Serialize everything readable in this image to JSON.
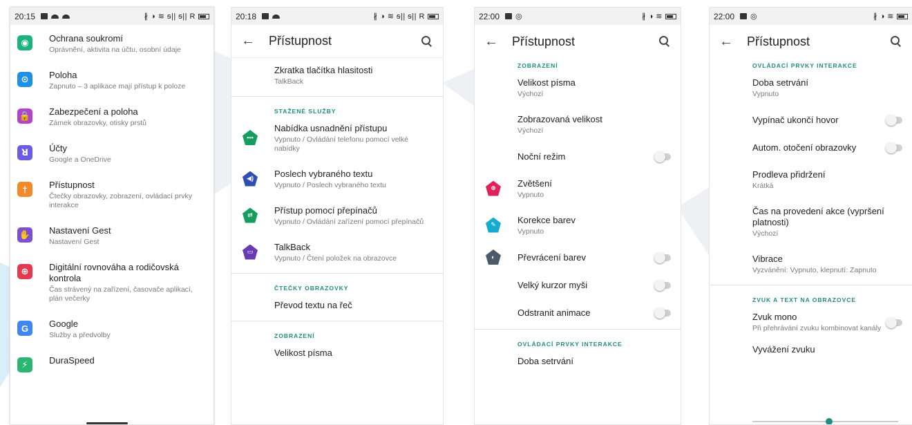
{
  "colors": {
    "accent": "#1e8e7e"
  },
  "phone1": {
    "status": {
      "time": "20:15",
      "right": "∦ ◑ ≋ ᵴ|| ᵴ|| R"
    },
    "items": [
      {
        "icon": "eye-lock-icon",
        "color": "#1bb37e",
        "title": "Ochrana soukromí",
        "subtitle": "Oprávnění, aktivita na účtu, osobní údaje"
      },
      {
        "icon": "location-pin-icon",
        "color": "#1e90e5",
        "title": "Poloha",
        "subtitle": "Zapnuto – 3 aplikace mají přístup k poloze"
      },
      {
        "icon": "padlock-icon",
        "color": "#b344c9",
        "title": "Zabezpečení a poloha",
        "subtitle": "Zámek obrazovky, otisky prstů"
      },
      {
        "icon": "person-icon",
        "color": "#6b5ce6",
        "title": "Účty",
        "subtitle": "Google a OneDrive"
      },
      {
        "icon": "accessibility-icon",
        "color": "#f28a2a",
        "title": "Přístupnost",
        "subtitle": "Čtečky obrazovky, zobrazení, ovládací prvky interakce"
      },
      {
        "icon": "hand-gesture-icon",
        "color": "#7b4fd6",
        "title": "Nastavení Gest",
        "subtitle": "Nastavení Gest"
      },
      {
        "icon": "heart-plus-icon",
        "color": "#e23b4f",
        "title": "Digitální rovnováha a rodičovská kontrola",
        "subtitle": "Čas strávený na zařízení, časovače aplikací, plán večerky"
      },
      {
        "icon": "google-g-icon",
        "color": "#3f86f0",
        "title": "Google",
        "subtitle": "Služby a předvolby"
      },
      {
        "icon": "rocket-icon",
        "color": "#2bb673",
        "title": "DuraSpeed",
        "subtitle": ""
      }
    ]
  },
  "phone2": {
    "status": {
      "time": "20:18",
      "right": "∦ ◑ ≋ ᵴ|| ᵴ|| R"
    },
    "title": "Přístupnost",
    "top_item": {
      "title": "Zkratka tlačítka hlasitosti",
      "subtitle": "TalkBack"
    },
    "section1": "STAŽENÉ SLUŽBY",
    "services": [
      {
        "icon": "menu-dots-icon",
        "color": "#159d5f",
        "glyph": "•••",
        "title": "Nabídka usnadnění přístupu",
        "subtitle": "Vypnuto / Ovládání telefonu pomocí velké nabídky"
      },
      {
        "icon": "speaker-icon",
        "color": "#2f4fb5",
        "glyph": "◀)",
        "title": "Poslech vybraného textu",
        "subtitle": "Vypnuto / Poslech vybraného textu"
      },
      {
        "icon": "switch-access-icon",
        "color": "#159d5f",
        "glyph": "⇄",
        "title": "Přístup pomocí přepínačů",
        "subtitle": "Vypnuto / Ovládání zařízení pomocí přepínačů"
      },
      {
        "icon": "talkback-icon",
        "color": "#6a3ab5",
        "glyph": "▭",
        "title": "TalkBack",
        "subtitle": "Vypnuto / Čtení položek na obrazovce"
      }
    ],
    "section2": "ČTEČKY OBRAZOVKY",
    "tts": "Převod textu na řeč",
    "section3": "ZOBRAZENÍ",
    "font_size": "Velikost písma"
  },
  "phone3": {
    "status": {
      "time": "22:00",
      "right": "∦ ◑ ≋"
    },
    "title": "Přístupnost",
    "section1": "ZOBRAZENÍ",
    "font_size": {
      "title": "Velikost písma",
      "subtitle": "Výchozí"
    },
    "display_size": {
      "title": "Zobrazovaná velikost",
      "subtitle": "Výchozí"
    },
    "night_mode": "Noční režim",
    "magnification": {
      "icon": "magnifier-icon",
      "color": "#e0215a",
      "title": "Zvětšení",
      "subtitle": "Vypnuto"
    },
    "color_correction": {
      "icon": "pen-icon",
      "color": "#17aacf",
      "title": "Korekce barev",
      "subtitle": "Vypnuto"
    },
    "color_inversion": {
      "icon": "contrast-icon",
      "color": "#4a5a6a",
      "title": "Převrácení barev"
    },
    "large_cursor": "Velký kurzor myši",
    "remove_animations": "Odstranit animace",
    "section2": "OVLÁDACÍ PRVKY INTERAKCE",
    "dwell": "Doba setrvání"
  },
  "phone4": {
    "status": {
      "time": "22:00",
      "right": "∦ ◑ ≋"
    },
    "title": "Přístupnost",
    "section1": "OVLÁDACÍ PRVKY INTERAKCE",
    "dwell": {
      "title": "Doba setrvání",
      "subtitle": "Vypnuto"
    },
    "power_ends_call": "Vypínač ukončí hovor",
    "auto_rotate": "Autom. otočení obrazovky",
    "touch_hold": {
      "title": "Prodleva přidržení",
      "subtitle": "Krátká"
    },
    "action_time": {
      "title": "Čas na provedení akce (vypršení platnosti)",
      "subtitle": "Výchozí"
    },
    "vibration": {
      "title": "Vibrace",
      "subtitle": "Vyzvánění: Vypnuto, klepnutí: Zapnuto"
    },
    "section2": "ZVUK A TEXT NA OBRAZOVCE",
    "mono": {
      "title": "Zvuk mono",
      "subtitle": "Při přehrávání zvuku kombinovat kanály"
    },
    "balance": "Vyvážení zvuku"
  }
}
